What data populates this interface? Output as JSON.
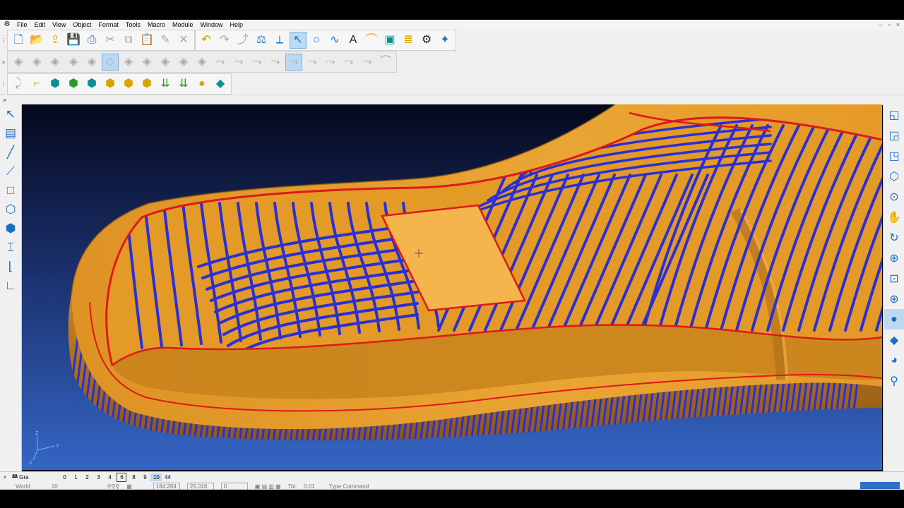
{
  "menu": [
    "File",
    "Edit",
    "View",
    "Object",
    "Format",
    "Tools",
    "Macro",
    "Module",
    "Window",
    "Help"
  ],
  "window_controls": [
    "–",
    "▫",
    "×"
  ],
  "toolbar1": {
    "group1": [
      {
        "icon": "new-file-icon",
        "glyph": "🗋"
      },
      {
        "icon": "open-folder-icon",
        "glyph": "📂"
      },
      {
        "icon": "import-icon",
        "glyph": "⇪"
      },
      {
        "icon": "save-icon",
        "glyph": "💾"
      },
      {
        "icon": "print-icon",
        "glyph": "⎙"
      },
      {
        "icon": "cut-icon",
        "glyph": "✂"
      },
      {
        "icon": "copy-icon",
        "glyph": "⧉"
      },
      {
        "icon": "paste-icon",
        "glyph": "📋"
      },
      {
        "icon": "edit-icon",
        "glyph": "✎"
      },
      {
        "icon": "delete-icon",
        "glyph": "✕"
      }
    ],
    "group2": [
      {
        "icon": "undo-icon",
        "glyph": "↶"
      },
      {
        "icon": "redo-icon",
        "glyph": "↷"
      },
      {
        "icon": "transform-icon",
        "glyph": "⤴"
      },
      {
        "icon": "measure-icon",
        "glyph": "⚖"
      },
      {
        "icon": "axis-icon",
        "glyph": "⟂"
      },
      {
        "icon": "select-curve-icon",
        "glyph": "↖"
      },
      {
        "icon": "circle-icon",
        "glyph": "○"
      },
      {
        "icon": "spline-icon",
        "glyph": "∿"
      },
      {
        "icon": "text-icon",
        "glyph": "A"
      },
      {
        "icon": "sweep-icon",
        "glyph": "⌒"
      },
      {
        "icon": "box-solid-icon",
        "glyph": "▣"
      },
      {
        "icon": "layers-icon",
        "glyph": "≣"
      },
      {
        "icon": "machine-icon",
        "glyph": "⚙"
      },
      {
        "icon": "magic-wand-icon",
        "glyph": "✦"
      }
    ]
  },
  "toolbar2": [
    {
      "icon": "surface-a-icon",
      "glyph": "◈"
    },
    {
      "icon": "surface-b-icon",
      "glyph": "◈"
    },
    {
      "icon": "surface-c-icon",
      "glyph": "◈"
    },
    {
      "icon": "surface-d-icon",
      "glyph": "◈"
    },
    {
      "icon": "surface-e-icon",
      "glyph": "◈"
    },
    {
      "icon": "surface-f-icon",
      "glyph": "◇"
    },
    {
      "icon": "surface-g-icon",
      "glyph": "◈"
    },
    {
      "icon": "surface-h-icon",
      "glyph": "◈"
    },
    {
      "icon": "surface-i-icon",
      "glyph": "◈"
    },
    {
      "icon": "surface-j-icon",
      "glyph": "◈"
    },
    {
      "icon": "surface-k-icon",
      "glyph": "◈"
    },
    {
      "icon": "curve-a-icon",
      "glyph": "⤳"
    },
    {
      "icon": "curve-b-icon",
      "glyph": "⤳"
    },
    {
      "icon": "curve-c-icon",
      "glyph": "⤳"
    },
    {
      "icon": "curve-d-icon",
      "glyph": "⤳"
    },
    {
      "icon": "curve-e-icon",
      "glyph": "⤳"
    },
    {
      "icon": "curve-f-icon",
      "glyph": "⤳"
    },
    {
      "icon": "curve-g-icon",
      "glyph": "⤳"
    },
    {
      "icon": "curve-h-icon",
      "glyph": "⤳"
    },
    {
      "icon": "curve-i-icon",
      "glyph": "⤳"
    },
    {
      "icon": "curve-j-icon",
      "glyph": "⌒"
    }
  ],
  "toolbar3": [
    {
      "icon": "line-gray-icon",
      "glyph": "⤸"
    },
    {
      "icon": "tool-path-icon",
      "glyph": "⌐"
    },
    {
      "icon": "solid-move-icon",
      "glyph": "⬢"
    },
    {
      "icon": "solid-rotate-icon",
      "glyph": "⬢"
    },
    {
      "icon": "solid-boolean-icon",
      "glyph": "⬢"
    },
    {
      "icon": "solid-box-icon",
      "glyph": "⬢"
    },
    {
      "icon": "solid-array-icon",
      "glyph": "⬢"
    },
    {
      "icon": "solid-grid-icon",
      "glyph": "⬢"
    },
    {
      "icon": "project-down-icon",
      "glyph": "⇊"
    },
    {
      "icon": "project-grid-icon",
      "glyph": "⇊"
    },
    {
      "icon": "shade-sphere-icon",
      "glyph": "●"
    },
    {
      "icon": "navigate-icon",
      "glyph": "◆"
    }
  ],
  "left_tools": [
    {
      "icon": "pointer-icon",
      "glyph": "↖"
    },
    {
      "icon": "layer-manager-icon",
      "glyph": "▤"
    },
    {
      "icon": "line-icon",
      "glyph": "╱"
    },
    {
      "icon": "polyline-icon",
      "glyph": "⟋"
    },
    {
      "icon": "rectangle-icon",
      "glyph": "□"
    },
    {
      "icon": "polygon-icon",
      "glyph": "⬡"
    },
    {
      "icon": "cube-icon",
      "glyph": "⬢"
    },
    {
      "icon": "dimension-icon",
      "glyph": "⌶"
    },
    {
      "icon": "arc-icon",
      "glyph": "⌊"
    },
    {
      "icon": "corner-icon",
      "glyph": "∟"
    }
  ],
  "right_tools": [
    {
      "icon": "view-front-icon",
      "glyph": "◱"
    },
    {
      "icon": "view-top-icon",
      "glyph": "◲"
    },
    {
      "icon": "view-side-icon",
      "glyph": "◳"
    },
    {
      "icon": "view-iso-icon",
      "glyph": "⬡"
    },
    {
      "icon": "view-perspective-icon",
      "glyph": "⊙"
    },
    {
      "icon": "pan-icon",
      "glyph": "✋"
    },
    {
      "icon": "rotate-view-icon",
      "glyph": "↻"
    },
    {
      "icon": "zoom-window-icon",
      "glyph": "⊕"
    },
    {
      "icon": "zoom-extents-icon",
      "glyph": "⊡"
    },
    {
      "icon": "wireframe-globe-icon",
      "glyph": "⊕"
    },
    {
      "icon": "shaded-sphere-icon",
      "glyph": "●"
    },
    {
      "icon": "shaded-box-icon",
      "glyph": "◆"
    },
    {
      "icon": "material-sphere-icon",
      "glyph": "◕"
    },
    {
      "icon": "render-icon",
      "glyph": "⚲"
    }
  ],
  "statusbar": {
    "tab_label": "Gra",
    "views": [
      "0",
      "1",
      "2",
      "3",
      "4",
      "6",
      "8",
      "9",
      "10",
      "44"
    ],
    "boxed_view": "6",
    "active_view": "10",
    "row2": {
      "coord_system": "World",
      "value1": "10",
      "coord_x": "184.264",
      "coord_y": "25.016",
      "coord_z": "0",
      "tol_label": "Tol.",
      "tol_value": "0.01",
      "command_prompt": "Type Command"
    }
  },
  "viewport": {
    "axes": {
      "x": "X",
      "y": "Y",
      "z": "Z"
    },
    "colors": {
      "background_top": "#06091c",
      "background_bottom": "#2f5fbb",
      "mold": "#e29a24",
      "mold_dark": "#b9741a",
      "mold_light": "#f2b447",
      "toolpath": "#2a2fd6",
      "boundary": "#e01818",
      "patch": "#f4b64c"
    }
  }
}
